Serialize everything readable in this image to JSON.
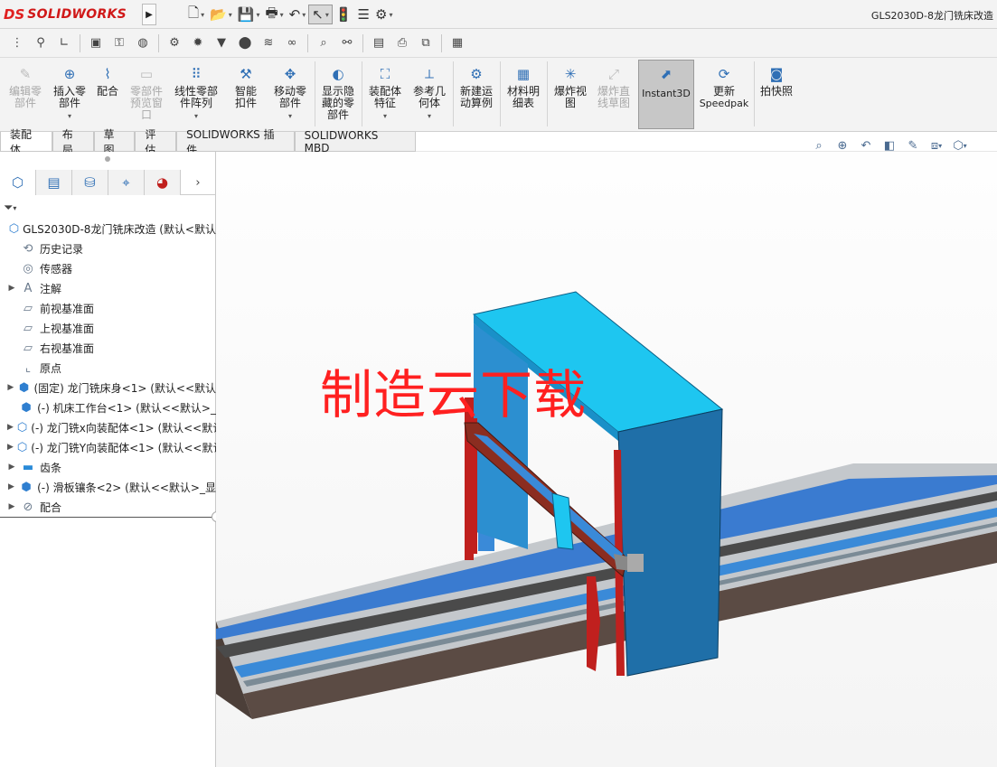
{
  "app": {
    "logo_mark": "DS",
    "logo_text": "SOLIDWORKS",
    "document_title": "GLS2030D-8龙门铣床改造"
  },
  "quick_access": [
    {
      "name": "new-document-icon",
      "glyph": "🗋"
    },
    {
      "name": "open-folder-icon",
      "glyph": "📂"
    },
    {
      "name": "save-icon",
      "glyph": "💾"
    },
    {
      "name": "print-icon",
      "glyph": "🖶"
    },
    {
      "name": "undo-icon",
      "glyph": "↶"
    },
    {
      "name": "select-cursor-icon",
      "glyph": "↖"
    },
    {
      "name": "rebuild-traffic-light-icon",
      "glyph": "🚦"
    },
    {
      "name": "file-properties-icon",
      "glyph": "☰"
    },
    {
      "name": "options-gear-icon",
      "glyph": "⚙"
    }
  ],
  "ribbon": {
    "edit_component": "编辑零部件",
    "insert_components": "插入零部件",
    "mate": "配合",
    "component_preview": "零部件预览窗口",
    "linear_pattern": "线性零部件阵列",
    "smart_fasteners": "智能扣件",
    "move_component": "移动零部件",
    "show_hidden": "显示隐藏的零部件",
    "assembly_features": "装配体特征",
    "reference_geometry": "参考几何体",
    "new_motion_study": "新建运动算例",
    "bill_of_materials": "材料明细表",
    "exploded_view": "爆炸视图",
    "explode_line_sketch": "爆炸直线草图",
    "instant3d": "Instant3D",
    "update_speedpak_1": "更新",
    "update_speedpak_2": "Speedpak",
    "take_snapshot": "拍快照"
  },
  "tabs": [
    "装配体",
    "布局",
    "草图",
    "评估",
    "SOLIDWORKS 插件",
    "SOLIDWORKS MBD"
  ],
  "tree": [
    {
      "label": "GLS2030D-8龙门铣床改造 (默认<默认",
      "icon": "assembly-icon",
      "glyph": "⬡",
      "expand": "",
      "indent": 0
    },
    {
      "label": "历史记录",
      "icon": "history-icon",
      "glyph": "⟲",
      "expand": "",
      "indent": 1
    },
    {
      "label": "传感器",
      "icon": "sensor-icon",
      "glyph": "◎",
      "expand": "",
      "indent": 1
    },
    {
      "label": "注解",
      "icon": "annotations-icon",
      "glyph": "A",
      "expand": "▶",
      "indent": 1
    },
    {
      "label": "前视基准面",
      "icon": "plane-icon",
      "glyph": "▱",
      "expand": "",
      "indent": 1
    },
    {
      "label": "上视基准面",
      "icon": "plane-icon",
      "glyph": "▱",
      "expand": "",
      "indent": 1
    },
    {
      "label": "右视基准面",
      "icon": "plane-icon",
      "glyph": "▱",
      "expand": "",
      "indent": 1
    },
    {
      "label": "原点",
      "icon": "origin-icon",
      "glyph": "⌞",
      "expand": "",
      "indent": 1
    },
    {
      "label": "(固定) 龙门铣床身<1> (默认<<默认",
      "icon": "part-icon",
      "glyph": "⬢",
      "expand": "▶",
      "indent": 1
    },
    {
      "label": "(-) 机床工作台<1> (默认<<默认>_",
      "icon": "part-icon",
      "glyph": "⬢",
      "expand": "",
      "indent": 1
    },
    {
      "label": "(-) 龙门铣x向装配体<1> (默认<<默认",
      "icon": "subassembly-icon",
      "glyph": "⬡",
      "expand": "▶",
      "indent": 1
    },
    {
      "label": "(-) 龙门铣Y向装配体<1> (默认<<默认",
      "icon": "subassembly-icon",
      "glyph": "⬡",
      "expand": "▶",
      "indent": 1
    },
    {
      "label": "齿条",
      "icon": "folder-icon",
      "glyph": "▬",
      "expand": "▶",
      "indent": 1
    },
    {
      "label": "(-) 滑板镶条<2> (默认<<默认>_显",
      "icon": "part-icon",
      "glyph": "⬢",
      "expand": "▶",
      "indent": 1
    },
    {
      "label": "配合",
      "icon": "mates-icon",
      "glyph": "⊘",
      "expand": "▶",
      "indent": 1
    }
  ],
  "watermark": "制造云下载",
  "colors": {
    "gantry_blue": "#1f6fa8",
    "gantry_top": "#1ec6f0",
    "bed_brown": "#5b4b44",
    "frame_red": "#c0201e",
    "watermark_red": "#ff2020",
    "instant3d_active": "#c7c7c7"
  }
}
